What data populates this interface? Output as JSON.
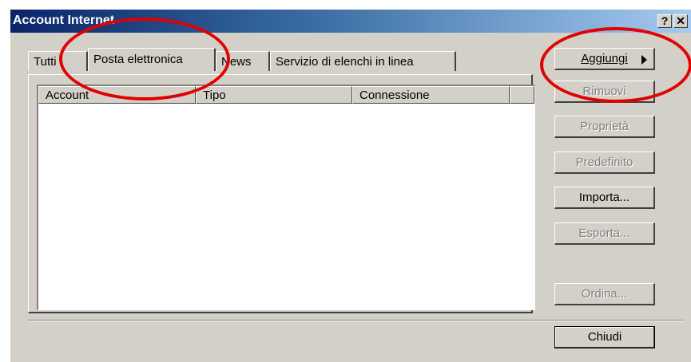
{
  "window": {
    "title": "Account Internet",
    "help_button": "?",
    "close_button": "✕"
  },
  "tabs": [
    {
      "label": "Tutti",
      "active": false
    },
    {
      "label": "Posta elettronica",
      "active": true
    },
    {
      "label": "News",
      "active": false
    },
    {
      "label": "Servizio di elenchi in linea",
      "active": false
    }
  ],
  "list": {
    "columns": [
      "Account",
      "Tipo",
      "Connessione"
    ],
    "rows": []
  },
  "buttons": {
    "aggiungi": {
      "label": "Aggiungi",
      "enabled": true
    },
    "rimuovi": {
      "label": "Rimuovi",
      "enabled": false
    },
    "proprieta": {
      "label": "Proprietà",
      "enabled": false
    },
    "predefinito": {
      "label": "Predefinito",
      "enabled": false
    },
    "importa": {
      "label": "Importa...",
      "enabled": true
    },
    "esporta": {
      "label": "Esporta...",
      "enabled": false
    },
    "ordina": {
      "label": "Ordina...",
      "enabled": false
    },
    "chiudi": {
      "label": "Chiudi",
      "enabled": true
    }
  },
  "colors": {
    "dialog_face": "#d4d0c8",
    "title_gradient_start": "#0a246a",
    "title_gradient_end": "#a6caf0",
    "annotation": "#e00000"
  }
}
